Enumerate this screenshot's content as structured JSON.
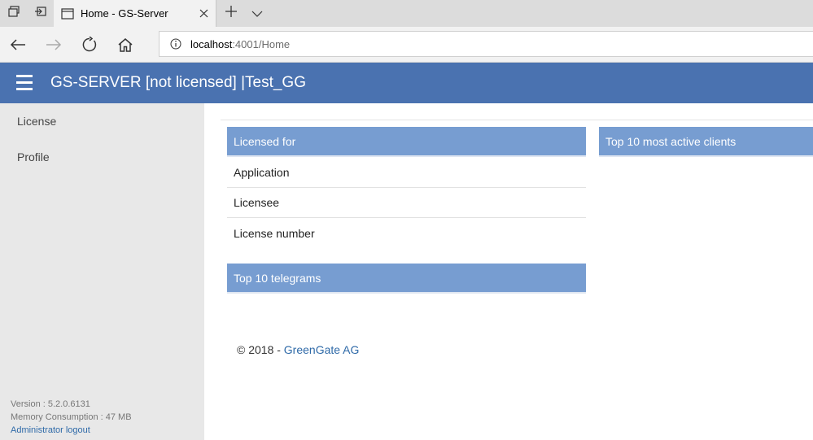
{
  "browser": {
    "tab_title": "Home - GS-Server",
    "url_host": "localhost",
    "url_rest": ":4001/Home",
    "icons": [
      "tab-manager-icon",
      "set-aside-tabs-icon",
      "page-icon",
      "close-icon",
      "new-tab-icon",
      "chevron-down-icon",
      "back-arrow-icon",
      "forward-arrow-icon",
      "refresh-icon",
      "home-icon",
      "info-icon"
    ]
  },
  "header": {
    "title": "GS-SERVER [not licensed] |Test_GG",
    "background": "#4a72b0"
  },
  "sidebar": {
    "items": [
      {
        "label": "License"
      },
      {
        "label": "Profile"
      }
    ],
    "version": "Version : 5.2.0.6131",
    "memory": "Memory Consumption : 47 MB",
    "logout": "Administrator logout"
  },
  "main": {
    "licensed_for": {
      "heading": "Licensed for",
      "rows": [
        "Application",
        "Licensee",
        "License number"
      ]
    },
    "top_telegrams": {
      "heading": "Top 10 telegrams"
    },
    "top_clients": {
      "heading": "Top 10 most active clients"
    },
    "panel_color": "#779dd1"
  },
  "footer": {
    "copyright": "© 2018 - ",
    "company": "GreenGate AG"
  }
}
